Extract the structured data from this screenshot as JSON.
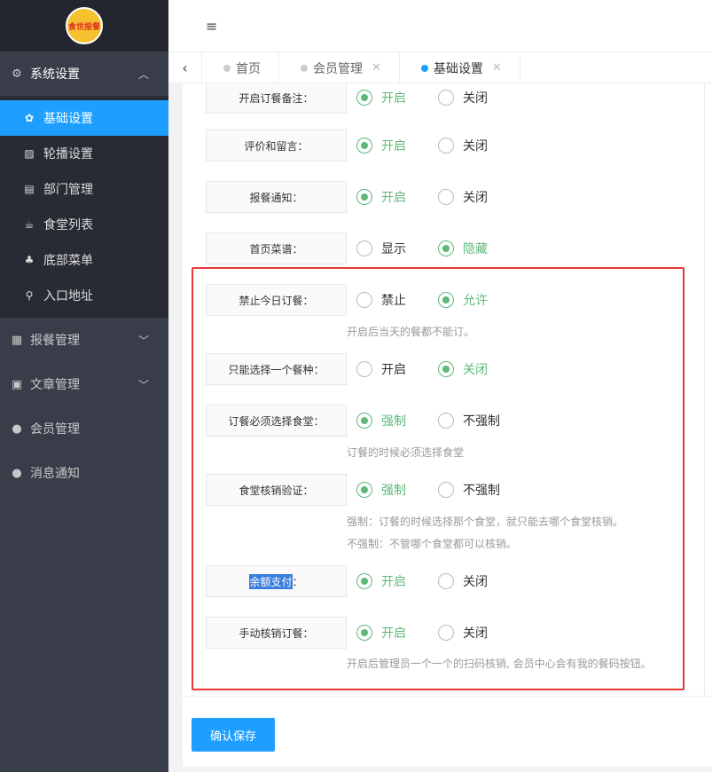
{
  "sidebar": {
    "logo_text": "食世报餐",
    "sections": [
      {
        "label": "系统设置",
        "icon": "gears-icon"
      },
      {
        "label": "报餐管理",
        "icon": "table-icon"
      },
      {
        "label": "文章管理",
        "icon": "newspaper-icon"
      },
      {
        "label": "会员管理",
        "icon": "user-icon"
      },
      {
        "label": "消息通知",
        "icon": "chat-icon"
      }
    ],
    "sub_items": [
      {
        "label": "基础设置",
        "icon": "gear-icon"
      },
      {
        "label": "轮播设置",
        "icon": "image-icon"
      },
      {
        "label": "部门管理",
        "icon": "document-icon"
      },
      {
        "label": "食堂列表",
        "icon": "coffee-icon"
      },
      {
        "label": "底部菜单",
        "icon": "sitemap-icon"
      },
      {
        "label": "入口地址",
        "icon": "search-icon"
      }
    ]
  },
  "header": {
    "menu_toggle": "≡"
  },
  "tabs": [
    {
      "label": "首页",
      "closable": false
    },
    {
      "label": "会员管理",
      "closable": true
    },
    {
      "label": "基础设置",
      "closable": true
    }
  ],
  "form": {
    "rows": [
      {
        "label": "开启订餐备注：",
        "opt1": "开启",
        "opt2": "关闭",
        "selected": 1
      },
      {
        "label": "评价和留言：",
        "opt1": "开启",
        "opt2": "关闭",
        "selected": 1
      },
      {
        "label": "报餐通知：",
        "opt1": "开启",
        "opt2": "关闭",
        "selected": 1
      },
      {
        "label": "首页菜谱：",
        "opt1": "显示",
        "opt2": "隐藏",
        "selected": 2
      },
      {
        "label": "禁止今日订餐：",
        "opt1": "禁止",
        "opt2": "允许",
        "selected": 2
      },
      {
        "label": "只能选择一个餐种：",
        "opt1": "开启",
        "opt2": "关闭",
        "selected": 2
      },
      {
        "label": "订餐必须选择食堂：",
        "opt1": "强制",
        "opt2": "不强制",
        "selected": 1
      },
      {
        "label": "食堂核销验证：",
        "opt1": "强制",
        "opt2": "不强制",
        "selected": 1
      },
      {
        "label_highlight": "余额支付",
        "label_rest": "：",
        "opt1": "开启",
        "opt2": "关闭",
        "selected": 1
      },
      {
        "label": "手动核销订餐：",
        "opt1": "开启",
        "opt2": "关闭",
        "selected": 1
      }
    ],
    "hints": [
      "开启后当天的餐都不能订。",
      "订餐的时候必须选择食堂",
      "强制：订餐的时候选择那个食堂，就只能去哪个食堂核销。",
      "不强制：不管哪个食堂都可以核销。",
      "开启后管理员一个一个的扫码核销, 会员中心会有我的餐码按钮。"
    ],
    "save_label": "确认保存"
  },
  "colors": {
    "accent": "#1e9fff",
    "checked": "#5fb878",
    "sidebar": "#393d49",
    "highlight_box": "#e53935"
  }
}
